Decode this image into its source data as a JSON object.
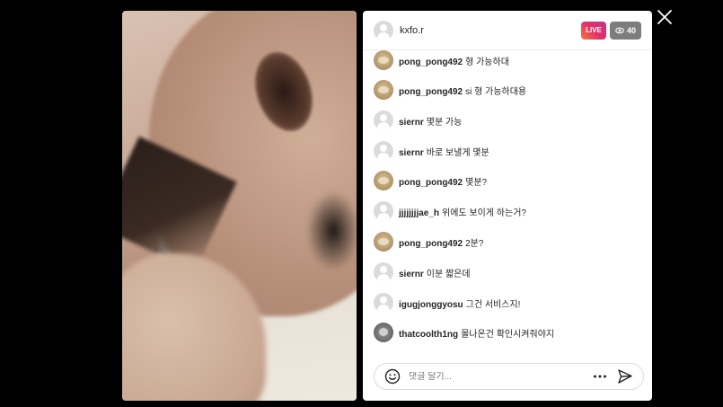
{
  "host": {
    "username": "kxfo.r"
  },
  "badges": {
    "live_label": "LIVE",
    "viewer_count": "40",
    "viewer_icon": "eye-icon"
  },
  "comments": [
    {
      "avatar": "dog",
      "user": "pong_pong492",
      "text": "형 가능하대"
    },
    {
      "avatar": "dog",
      "user": "pong_pong492",
      "text": "si 형 가능하대용"
    },
    {
      "avatar": "default",
      "user": "siernr",
      "text": "몇분 가능"
    },
    {
      "avatar": "default",
      "user": "siernr",
      "text": "바로 보낼게 몇분"
    },
    {
      "avatar": "dog",
      "user": "pong_pong492",
      "text": "몇분?"
    },
    {
      "avatar": "default",
      "user": "jjjjjjjjae_h",
      "text": "위에도 보이게 하는거?"
    },
    {
      "avatar": "dog",
      "user": "pong_pong492",
      "text": "2분?"
    },
    {
      "avatar": "default",
      "user": "siernr",
      "text": "이분 짧은데"
    },
    {
      "avatar": "default",
      "user": "igugjonggyosu",
      "text": "그건 서비스지!"
    },
    {
      "avatar": "pet",
      "user": "thatcoolth1ng",
      "text": "몰나온건 확인시켜줘야지"
    }
  ],
  "input": {
    "placeholder": "댓글 달기..."
  },
  "icons": {
    "emoji": "emoji-icon",
    "more": "more-icon",
    "send": "send-icon",
    "close": "close-icon"
  }
}
